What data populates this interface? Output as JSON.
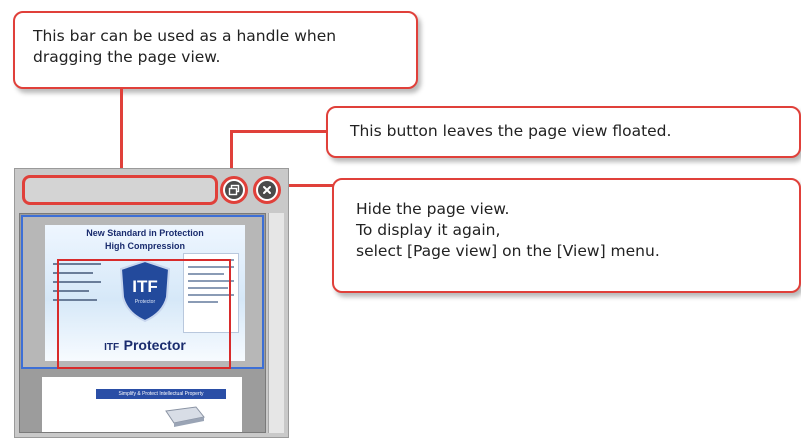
{
  "callouts": {
    "handle": "This bar can be used as a handle when dragging the page view.",
    "float": "This button leaves the page view floated.",
    "hide": [
      "Hide the page view.",
      "To display it again,",
      "select [Page view] on the [View] menu."
    ]
  },
  "page1": {
    "headline": "New Standard in Protection",
    "subheadline": "High Compression",
    "badge": "ITF",
    "badge_sub": "Protector",
    "brand_prefix": "ITF",
    "brand_name": "Protector"
  },
  "page2": {
    "banner": "Simplify & Protect Intellectual Property"
  },
  "icons": {
    "float_button": "restore-windows-icon",
    "close_button": "close-x-icon"
  },
  "colors": {
    "accent_red": "#e0403a",
    "selection_blue": "#3d6fd6",
    "brand_navy": "#1a2c6e"
  }
}
